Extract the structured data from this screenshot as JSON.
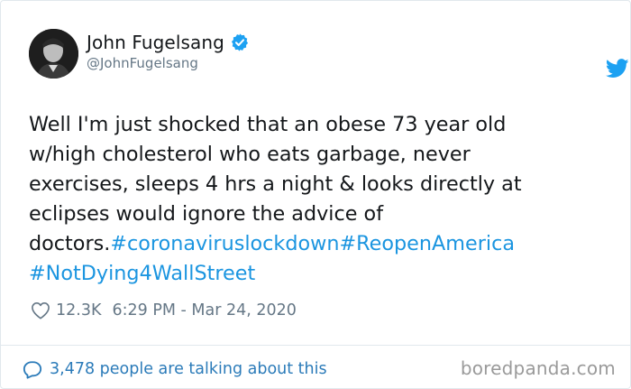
{
  "author": {
    "display_name": "John Fugelsang",
    "handle": "@JohnFugelsang"
  },
  "tweet": {
    "text_lines": [
      "Well I'm just shocked that an obese 73 year old",
      "w/high cholesterol who eats garbage, never",
      "exercises, sleeps 4 hrs a night & looks directly at",
      "eclipses would ignore the advice of"
    ],
    "last_text": "doctors.",
    "hashtags": [
      "#coronaviruslockdown",
      "#ReopenAmerica",
      "#NotDying4WallStreet"
    ]
  },
  "meta": {
    "likes": "12.3K",
    "timestamp": "6:29 PM - Mar 24, 2020"
  },
  "footer": {
    "conversation": "3,478 people are talking about this"
  },
  "watermark": "boredpanda.com",
  "colors": {
    "link": "#1b95e0",
    "verified": "#1da1f2",
    "muted": "#657786",
    "footer_link": "#2b7bb9"
  },
  "icons": [
    "verified-badge-icon",
    "twitter-bird-icon",
    "heart-icon",
    "reply-bubble-icon"
  ]
}
